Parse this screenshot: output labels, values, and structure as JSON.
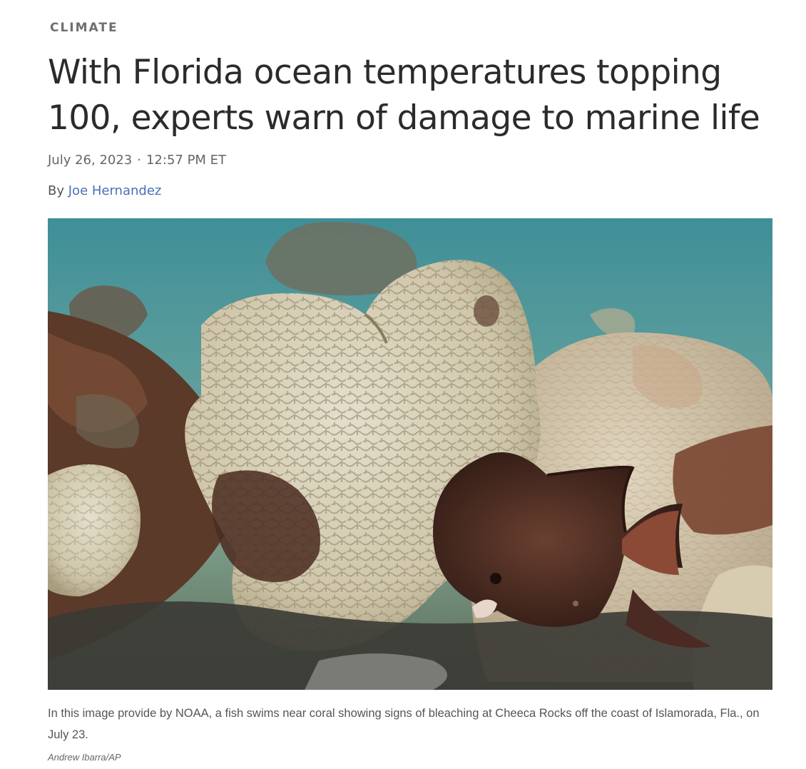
{
  "article": {
    "section": "CLIMATE",
    "headline": "With Florida ocean temperatures topping 100, experts warn of damage to marine life",
    "date": "July 26, 2023",
    "separator": "·",
    "time": "12:57 PM ET",
    "byline_prefix": "By",
    "author": "Joe Hernandez",
    "image": {
      "alt": "Fish swimming near bleached brain coral at Cheeca Rocks",
      "caption": "In this image provide by NOAA, a fish swims near coral showing signs of bleaching at Cheeca Rocks off the coast of Islamorada, Fla., on July 23.",
      "credit": "Andrew Ibarra/AP"
    }
  },
  "colors": {
    "water_top": "#3f8f98",
    "water_mid": "#6aa7a2",
    "coral_bleached": "#d9d2bb",
    "reef_dark": "#5b3a2a",
    "fish": "#4a2a22",
    "link": "#4a6fb5"
  }
}
